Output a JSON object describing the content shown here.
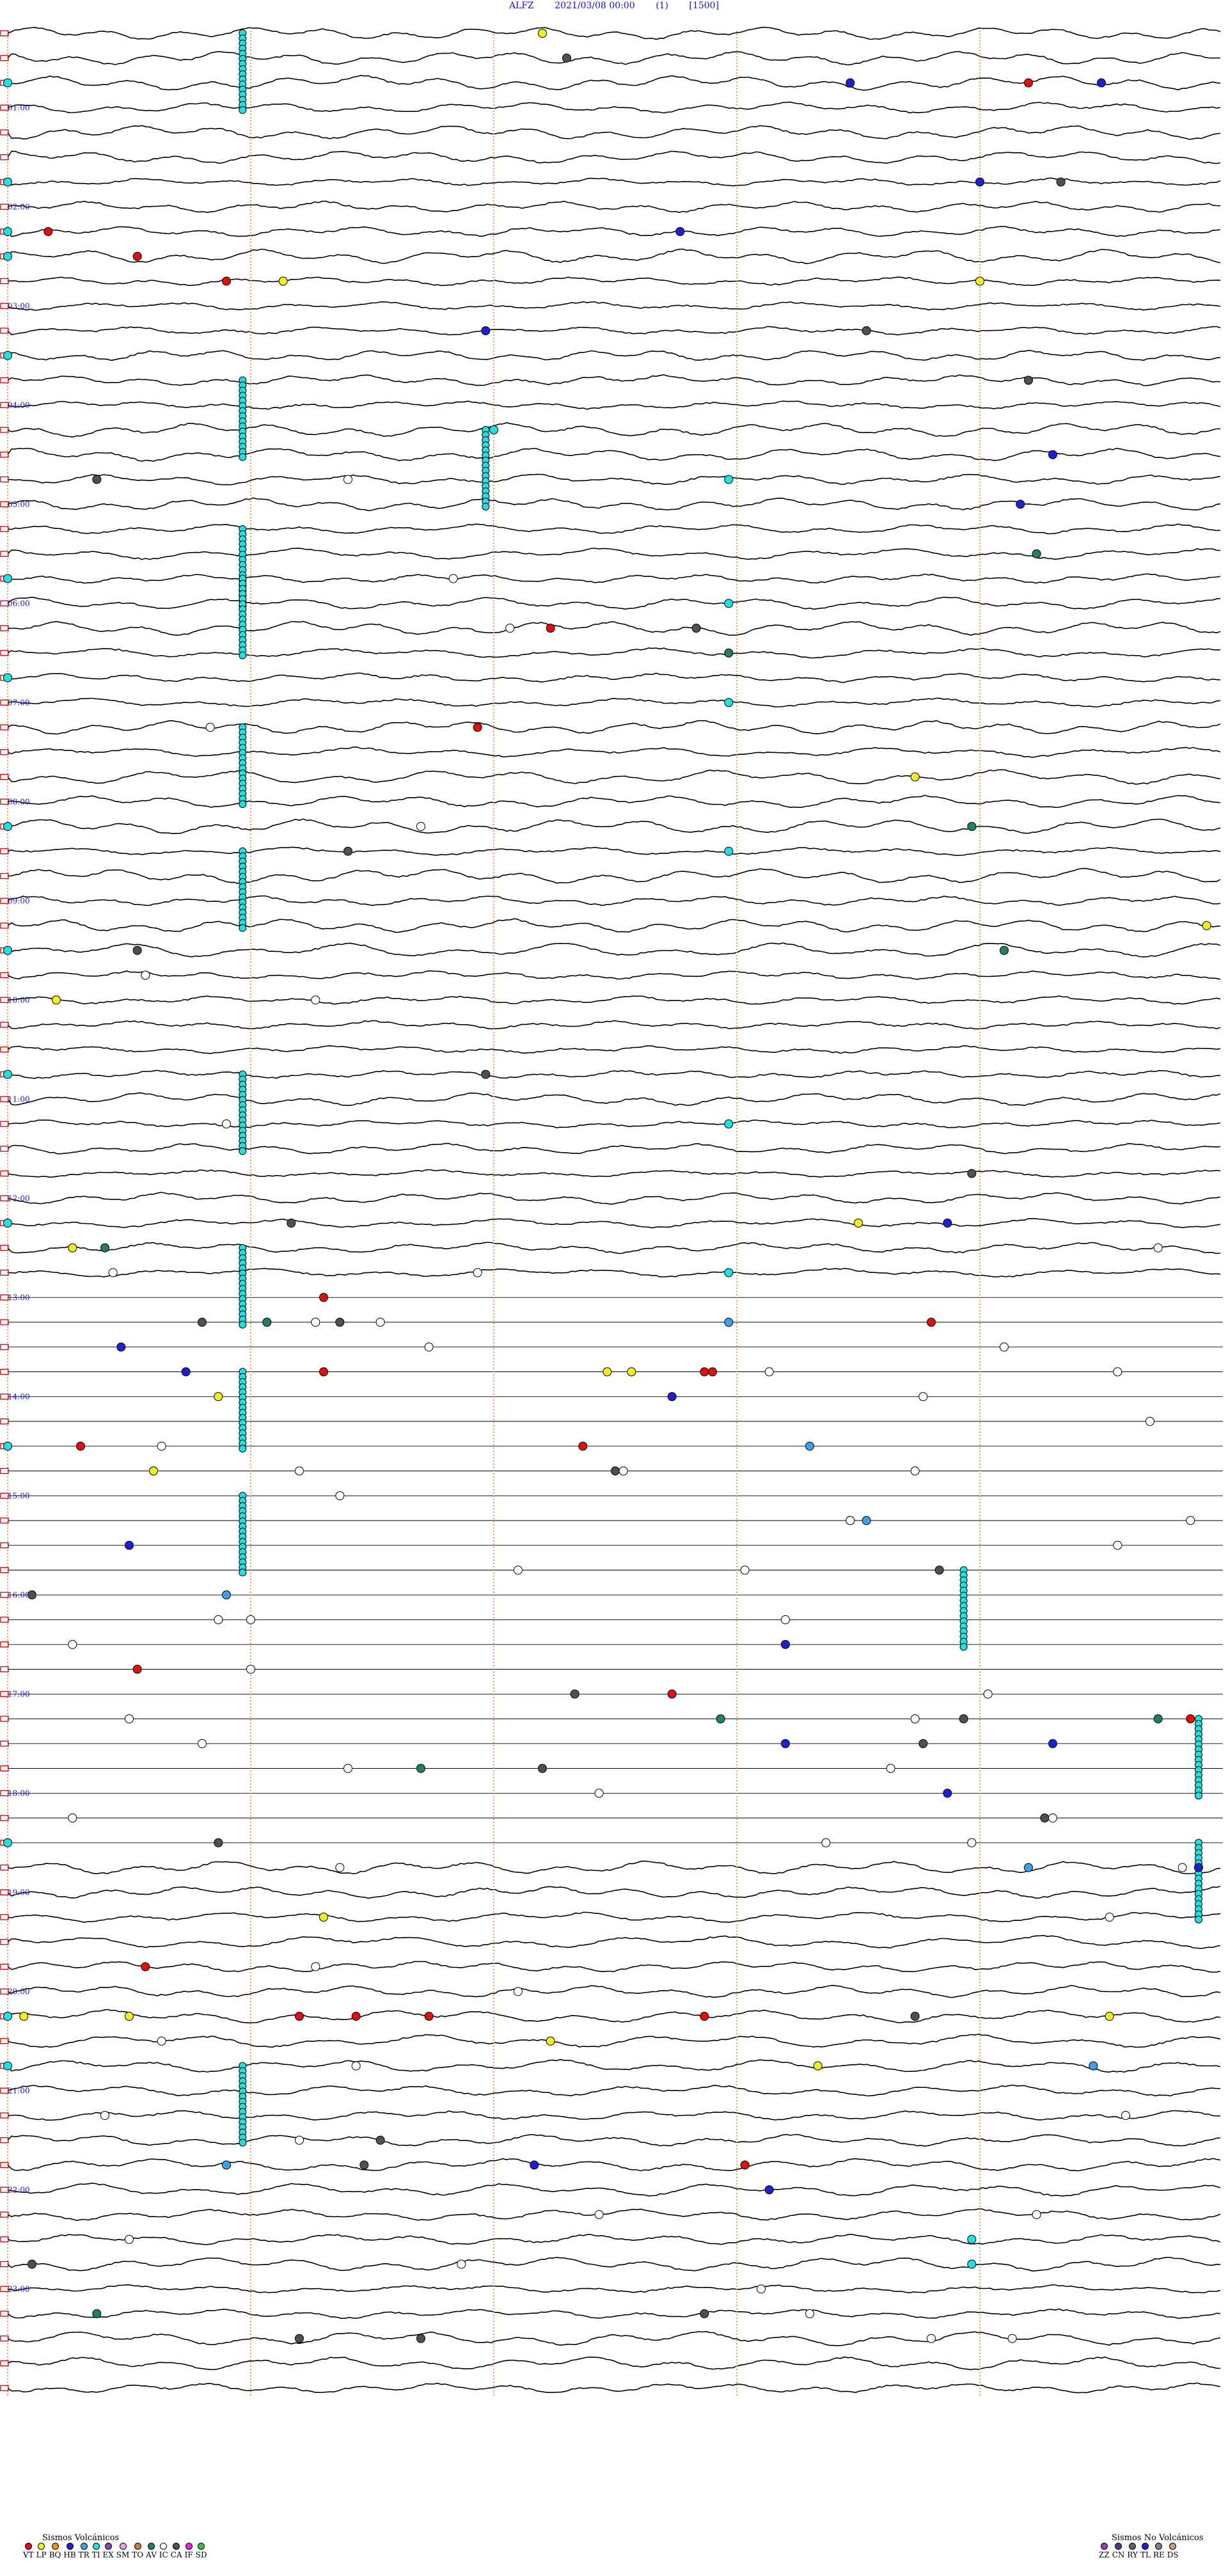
{
  "header": {
    "station": "ALFZ",
    "datetime": "2021/03/08 00:00",
    "channel": "(1)",
    "scale": "[1500]"
  },
  "chart_data": {
    "type": "helicorder",
    "rows_per_hour": 4,
    "minutes_per_row": 15,
    "hour_labels": [
      "01:00",
      "02:00",
      "03:00",
      "04:00",
      "05:00",
      "06:00",
      "07:00",
      "08:00",
      "09:00",
      "10:00",
      "11:00",
      "12:00",
      "13:00",
      "14:00",
      "15:00",
      "16:00",
      "17:00",
      "18:00",
      "19:00",
      "20:00",
      "21:00",
      "22:00",
      "23:00"
    ],
    "quiet_segment_hours": [
      12.75,
      18.5
    ],
    "colors": {
      "trace": "#000000",
      "minute_marks": "#e08050",
      "hour_label": "#1414c8",
      "row_end_marker": "#cc0000"
    },
    "events": {
      "VT": [
        [
          0.5,
          12.6
        ],
        [
          1.9,
          0.5
        ],
        [
          2.3,
          1.6
        ],
        [
          2.6,
          2.7
        ],
        [
          6.0,
          6.7
        ],
        [
          7.1,
          5.8
        ],
        [
          12.85,
          3.9
        ],
        [
          13.1,
          11.4
        ],
        [
          13.4,
          8.7
        ],
        [
          13.5,
          3.9
        ],
        [
          13.6,
          8.6
        ],
        [
          14.2,
          0.9
        ],
        [
          14.3,
          7.1
        ],
        [
          16.6,
          1.6
        ],
        [
          16.8,
          8.2
        ],
        [
          16.9,
          14.6
        ],
        [
          19.6,
          1.7
        ],
        [
          19.9,
          3.6
        ],
        [
          19.9,
          5.2
        ],
        [
          20.05,
          4.3
        ],
        [
          20.1,
          8.6
        ],
        [
          21.5,
          9.1
        ]
      ],
      "LP": [
        [
          0.1,
          6.6
        ],
        [
          2.5,
          3.4
        ],
        [
          2.6,
          12.0
        ],
        [
          7.5,
          11.2
        ],
        [
          9.0,
          14.8
        ],
        [
          9.7,
          0.6
        ],
        [
          12.1,
          10.5
        ],
        [
          12.3,
          0.8
        ],
        [
          13.5,
          7.4
        ],
        [
          13.6,
          7.7
        ],
        [
          13.8,
          2.6
        ],
        [
          14.5,
          1.8
        ],
        [
          18.9,
          3.9
        ],
        [
          20.05,
          13.6
        ],
        [
          20.1,
          1.5
        ],
        [
          20.1,
          0.2
        ],
        [
          20.3,
          6.7
        ],
        [
          20.4,
          10.0
        ]
      ],
      "TI_column": [
        [
          0.0,
          2.9
        ],
        [
          3.5,
          2.9
        ],
        [
          4.0,
          5.9
        ],
        [
          5.0,
          2.9
        ],
        [
          5.4,
          2.9
        ],
        [
          7.1,
          2.9
        ],
        [
          8.3,
          2.9
        ],
        [
          10.6,
          2.9
        ],
        [
          12.2,
          2.9
        ],
        [
          13.5,
          2.9
        ],
        [
          14.8,
          2.9
        ],
        [
          15.6,
          11.8
        ],
        [
          16.9,
          14.7
        ],
        [
          18.3,
          14.7
        ],
        [
          20.4,
          2.9
        ]
      ],
      "TI": [
        [
          0.5,
          0.0
        ],
        [
          1.4,
          0.0
        ],
        [
          1.9,
          0.0
        ],
        [
          2.3,
          0.0
        ],
        [
          3.3,
          0.0
        ],
        [
          4.0,
          6.0
        ],
        [
          4.6,
          8.9
        ],
        [
          5.5,
          0.0
        ],
        [
          5.8,
          8.9
        ],
        [
          6.6,
          0.0
        ],
        [
          6.8,
          8.9
        ],
        [
          8.1,
          0.0
        ],
        [
          8.3,
          8.9
        ],
        [
          9.3,
          0.0
        ],
        [
          10.5,
          0.0
        ],
        [
          10.9,
          8.9
        ],
        [
          12.0,
          0.0
        ],
        [
          12.4,
          8.9
        ],
        [
          14.3,
          0.0
        ],
        [
          18.3,
          0.0
        ],
        [
          20.0,
          0.0
        ],
        [
          20.5,
          0.0
        ],
        [
          22.3,
          11.9
        ],
        [
          22.6,
          11.9
        ]
      ],
      "HB": [
        [
          0.6,
          10.4
        ],
        [
          0.6,
          13.5
        ],
        [
          1.4,
          12.0
        ],
        [
          1.9,
          8.3
        ],
        [
          2.9,
          5.9
        ],
        [
          4.3,
          12.9
        ],
        [
          4.7,
          12.5
        ],
        [
          9.6,
          1.7
        ],
        [
          11.9,
          11.6
        ],
        [
          13.2,
          1.4
        ],
        [
          13.6,
          2.2
        ],
        [
          13.7,
          8.2
        ],
        [
          15.2,
          1.5
        ],
        [
          16.3,
          9.6
        ],
        [
          17.2,
          9.6
        ],
        [
          17.3,
          12.9
        ],
        [
          17.7,
          11.6
        ],
        [
          18.4,
          14.7
        ],
        [
          21.5,
          6.5
        ],
        [
          21.8,
          9.4
        ]
      ],
      "AV": [
        [
          5.2,
          12.7
        ],
        [
          6.3,
          8.9
        ],
        [
          8.0,
          11.9
        ],
        [
          9.3,
          12.3
        ],
        [
          12.2,
          1.2
        ],
        [
          13.0,
          3.2
        ],
        [
          16.9,
          8.8
        ],
        [
          17.1,
          14.2
        ],
        [
          17.6,
          5.1
        ],
        [
          22.9,
          1.1
        ]
      ],
      "IC": [
        [
          0.3,
          6.9
        ],
        [
          1.6,
          13.0
        ],
        [
          2.9,
          10.6
        ],
        [
          3.6,
          12.6
        ],
        [
          4.4,
          1.1
        ],
        [
          5.9,
          8.5
        ],
        [
          8.2,
          4.2
        ],
        [
          9.3,
          1.6
        ],
        [
          10.6,
          5.9
        ],
        [
          11.4,
          11.9
        ],
        [
          12.0,
          3.5
        ],
        [
          12.9,
          4.1
        ],
        [
          13.1,
          2.4
        ],
        [
          14.5,
          7.5
        ],
        [
          14.9,
          10.4
        ],
        [
          15.6,
          11.5
        ],
        [
          15.7,
          0.3
        ],
        [
          16.8,
          7.0
        ],
        [
          17.0,
          11.8
        ],
        [
          17.2,
          11.3
        ],
        [
          17.6,
          6.6
        ],
        [
          18.0,
          12.8
        ],
        [
          18.2,
          2.6
        ],
        [
          19.9,
          11.2
        ],
        [
          21.2,
          4.6
        ],
        [
          21.6,
          4.4
        ],
        [
          22.4,
          0.3
        ],
        [
          23.0,
          8.6
        ],
        [
          23.2,
          5.1
        ],
        [
          23.3,
          3.6
        ]
      ],
      "IC_open": [
        [
          4.5,
          4.2
        ],
        [
          5.6,
          5.5
        ],
        [
          6.1,
          6.2
        ],
        [
          7.0,
          2.5
        ],
        [
          7.9,
          5.1
        ],
        [
          9.5,
          1.7
        ],
        [
          9.7,
          3.8
        ],
        [
          11.1,
          2.7
        ],
        [
          12.2,
          14.2
        ],
        [
          12.5,
          5.8
        ],
        [
          12.6,
          1.3
        ],
        [
          12.9,
          3.8
        ],
        [
          13.0,
          4.6
        ],
        [
          13.3,
          5.2
        ],
        [
          13.3,
          12.3
        ],
        [
          13.5,
          9.4
        ],
        [
          13.6,
          13.7
        ],
        [
          13.7,
          11.3
        ],
        [
          14.1,
          14.1
        ],
        [
          14.2,
          1.9
        ],
        [
          14.4,
          7.6
        ],
        [
          14.5,
          11.2
        ],
        [
          14.6,
          3.6
        ],
        [
          14.7,
          4.1
        ],
        [
          15.0,
          10.4
        ],
        [
          15.1,
          14.6
        ],
        [
          15.3,
          13.7
        ],
        [
          15.5,
          9.1
        ],
        [
          15.6,
          6.3
        ],
        [
          15.9,
          3.0
        ],
        [
          16.1,
          9.6
        ],
        [
          16.1,
          2.6
        ],
        [
          16.2,
          0.8
        ],
        [
          16.6,
          3.0
        ],
        [
          16.8,
          12.1
        ],
        [
          16.9,
          11.2
        ],
        [
          17.1,
          1.5
        ],
        [
          17.3,
          2.4
        ],
        [
          17.5,
          4.2
        ],
        [
          17.6,
          10.9
        ],
        [
          17.8,
          7.3
        ],
        [
          17.9,
          0.8
        ],
        [
          18.0,
          12.9
        ],
        [
          18.2,
          10.1
        ],
        [
          18.3,
          11.9
        ],
        [
          18.4,
          14.5
        ],
        [
          18.6,
          4.1
        ],
        [
          19.0,
          13.6
        ],
        [
          19.6,
          3.8
        ],
        [
          19.8,
          6.3
        ],
        [
          20.3,
          1.9
        ],
        [
          20.6,
          4.3
        ],
        [
          20.9,
          1.2
        ],
        [
          21.1,
          13.8
        ],
        [
          21.3,
          3.6
        ],
        [
          21.9,
          12.7
        ],
        [
          22.1,
          7.3
        ],
        [
          22.3,
          1.5
        ],
        [
          22.5,
          5.6
        ],
        [
          22.8,
          9.3
        ],
        [
          23.0,
          9.9
        ],
        [
          23.2,
          11.4
        ],
        [
          23.3,
          12.4
        ]
      ],
      "TR": [
        [
          13.1,
          8.9
        ],
        [
          14.3,
          9.9
        ],
        [
          14.9,
          10.6
        ],
        [
          15.8,
          2.7
        ],
        [
          18.6,
          12.6
        ],
        [
          20.6,
          13.4
        ],
        [
          21.6,
          2.7
        ]
      ]
    }
  },
  "legend_volcanic": {
    "title": "Sismos Volcánicos",
    "items": [
      {
        "code": "VT",
        "color": "#e01010"
      },
      {
        "code": "LP",
        "color": "#f0f020"
      },
      {
        "code": "BQ",
        "color": "#f09020"
      },
      {
        "code": "HB",
        "color": "#2020d0"
      },
      {
        "code": "TR",
        "color": "#3fa0e8"
      },
      {
        "code": "TI",
        "color": "#20e0e0"
      },
      {
        "code": "EX",
        "color": "#9040c0"
      },
      {
        "code": "SM",
        "color": "#f0a0f0"
      },
      {
        "code": "TO",
        "color": "#c08040"
      },
      {
        "code": "AV",
        "color": "#208060"
      },
      {
        "code": "IC",
        "color": "#ffffff"
      },
      {
        "code": "CA",
        "color": "#505050"
      },
      {
        "code": "IF",
        "color": "#f020f0"
      },
      {
        "code": "SD",
        "color": "#40c040"
      }
    ]
  },
  "legend_nonvolcanic": {
    "title": "Sismos No Volcánicos",
    "items": [
      {
        "code": "ZZ",
        "color": "#9040c0"
      },
      {
        "code": "CN",
        "color": "#404080"
      },
      {
        "code": "RY",
        "color": "#606060"
      },
      {
        "code": "TL",
        "color": "#2020d0"
      },
      {
        "code": "RE",
        "color": "#808080"
      },
      {
        "code": "DS",
        "color": "#c0a080"
      }
    ]
  }
}
